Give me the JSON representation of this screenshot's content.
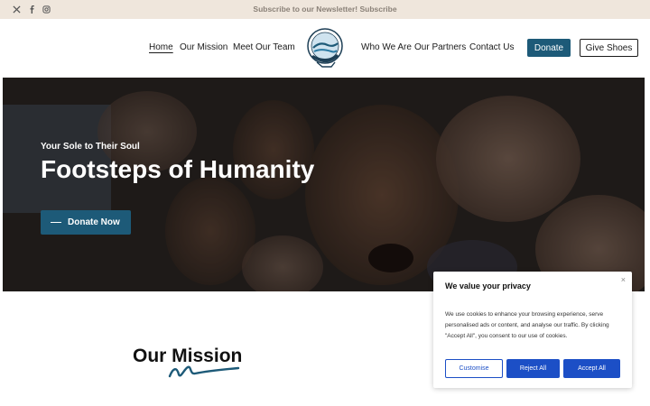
{
  "topbar": {
    "newsletter_text": "Subscribe to our Newsletter! Subscribe",
    "social_icons": [
      "x-icon",
      "facebook-icon",
      "instagram-icon"
    ]
  },
  "nav": {
    "left": [
      {
        "label": "Home",
        "active": true
      },
      {
        "label": "Our Mission"
      },
      {
        "label": "Meet Our Team"
      }
    ],
    "right": [
      {
        "label": "Who We Are"
      },
      {
        "label": "Our Partners"
      },
      {
        "label": "Contact Us"
      }
    ],
    "donate_label": "Donate",
    "give_shoes_label": "Give Shoes"
  },
  "hero": {
    "tagline": "Your Sole to Their Soul",
    "title": "Footsteps of Humanity",
    "button_label": "Donate Now"
  },
  "mission": {
    "title": "Our Mission"
  },
  "cookie": {
    "close": "×",
    "title": "We value your privacy",
    "text": "We use cookies to enhance your browsing experience, serve personalised ads or content, and analyse our traffic. By clicking \"Accept All\", you consent to our use of cookies.",
    "customise_label": "Customise",
    "reject_label": "Reject All",
    "accept_label": "Accept All"
  },
  "colors": {
    "accent": "#1d5a78",
    "topbar_bg": "#efe6dc",
    "cookie_button": "#1c4fc6"
  }
}
